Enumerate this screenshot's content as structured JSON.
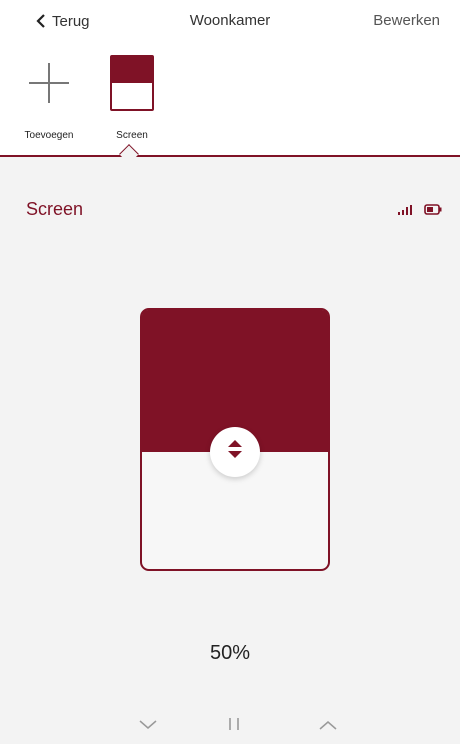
{
  "nav": {
    "back_label": "Terug",
    "title": "Woonkamer",
    "edit_label": "Bewerken"
  },
  "tiles": [
    {
      "label": "Toevoegen",
      "icon": "plus-icon"
    },
    {
      "label": "Screen",
      "icon": "screen-blind-icon",
      "selected": true
    }
  ],
  "device": {
    "name": "Screen",
    "signal_icon": "signal-icon",
    "battery_icon": "battery-icon"
  },
  "blind": {
    "position_percent": 50,
    "position_label": "50%"
  },
  "controls": {
    "down_icon": "chevron-down-icon",
    "stop_icon": "pause-icon",
    "up_icon": "chevron-up-icon"
  },
  "colors": {
    "accent": "#7f1226",
    "background": "#f3f3f3"
  }
}
